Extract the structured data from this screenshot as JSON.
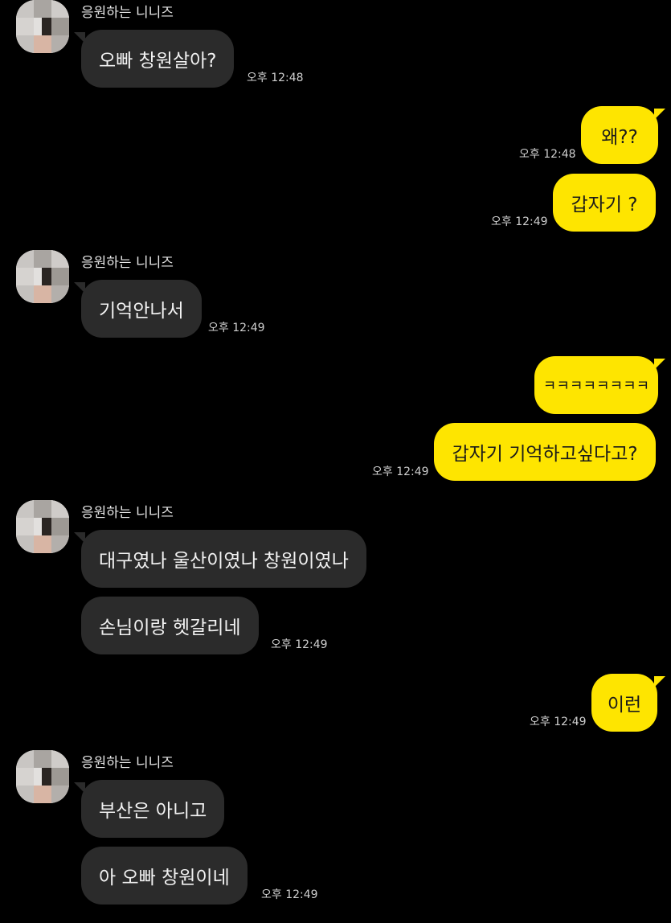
{
  "colors": {
    "background": "#000000",
    "incoming_bubble": "#2b2b2b",
    "outgoing_bubble": "#fee500"
  },
  "sender_name": "응원하는 니니즈",
  "messages": [
    {
      "id": 1,
      "direction": "in",
      "text": "오빠 창원살아?",
      "time": "오후 12:48"
    },
    {
      "id": 2,
      "direction": "out",
      "text": "왜??",
      "time": "오후 12:48"
    },
    {
      "id": 3,
      "direction": "out",
      "text": "갑자기 ?",
      "time": "오후 12:49"
    },
    {
      "id": 4,
      "direction": "in",
      "text": "기억안나서",
      "time": "오후 12:49"
    },
    {
      "id": 5,
      "direction": "out",
      "text": "ㅋㅋㅋㅋㅋㅋㅋㅋ",
      "time": ""
    },
    {
      "id": 6,
      "direction": "out",
      "text": "갑자기 기억하고싶다고?",
      "time": "오후 12:49"
    },
    {
      "id": 7,
      "direction": "in",
      "text": "대구였나 울산이였나 창원이였나",
      "time": ""
    },
    {
      "id": 8,
      "direction": "in",
      "text": "손님이랑 헷갈리네",
      "time": "오후 12:49"
    },
    {
      "id": 9,
      "direction": "out",
      "text": "이런",
      "time": "오후 12:49"
    },
    {
      "id": 10,
      "direction": "in",
      "text": "부산은 아니고",
      "time": ""
    },
    {
      "id": 11,
      "direction": "in",
      "text": "아 오빠 창원이네",
      "time": "오후 12:49"
    }
  ]
}
